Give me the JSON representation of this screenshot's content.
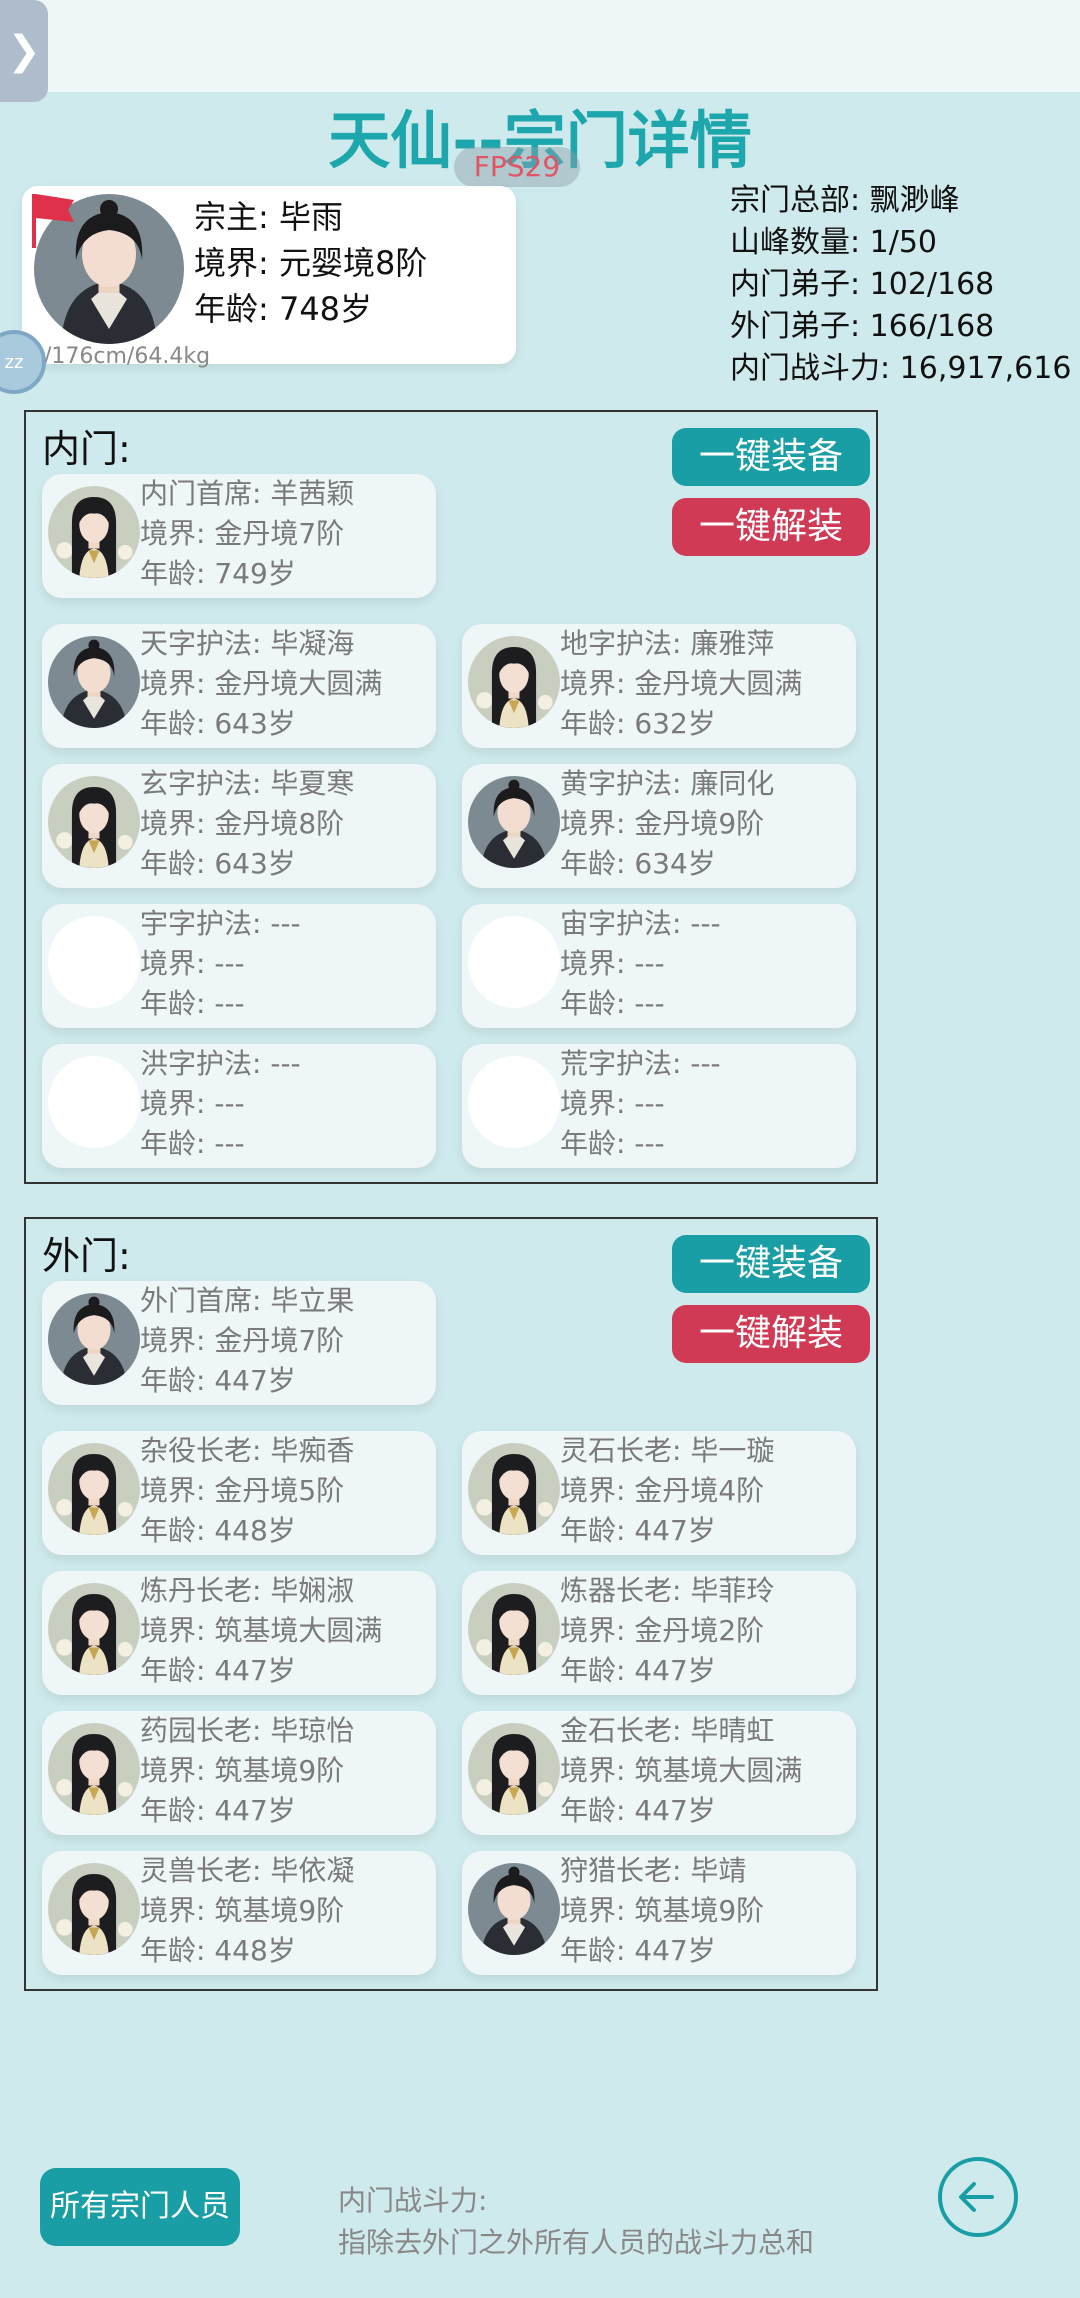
{
  "title": "天仙--宗门详情",
  "fps": "FPS29",
  "side_tab_glyph": "❯",
  "zz_badge": "zz",
  "leader": {
    "name_line": "宗主: 毕雨",
    "realm_line": "境界: 元婴境8阶",
    "age_line": "年龄: 748岁",
    "stats": "男/176cm/64.4kg",
    "avatar": "male"
  },
  "sect_info": {
    "hq": "宗门总部: 飘渺峰",
    "peaks": "山峰数量: 1/50",
    "inner_count": "内门弟子: 102/168",
    "outer_count": "外门弟子: 166/168",
    "power": "内门战斗力: 16,917,616"
  },
  "inner": {
    "label": "内门:",
    "equip_label": "一键装备",
    "unequip_label": "一键解装",
    "chief": {
      "title": "内门首席: 羊茜颖",
      "realm": "境界: 金丹境7阶",
      "age": "年龄: 749岁",
      "avatar": "female"
    },
    "members": [
      {
        "title": "天字护法: 毕凝海",
        "realm": "境界: 金丹境大圆满",
        "age": "年龄: 643岁",
        "avatar": "male"
      },
      {
        "title": "地字护法: 廉雅萍",
        "realm": "境界: 金丹境大圆满",
        "age": "年龄: 632岁",
        "avatar": "female"
      },
      {
        "title": "玄字护法: 毕夏寒",
        "realm": "境界: 金丹境8阶",
        "age": "年龄: 643岁",
        "avatar": "female"
      },
      {
        "title": "黄字护法: 廉同化",
        "realm": "境界: 金丹境9阶",
        "age": "年龄: 634岁",
        "avatar": "male"
      },
      {
        "title": "宇字护法: ---",
        "realm": "境界: ---",
        "age": "年龄: ---",
        "avatar": "empty"
      },
      {
        "title": "宙字护法: ---",
        "realm": "境界: ---",
        "age": "年龄: ---",
        "avatar": "empty"
      },
      {
        "title": "洪字护法: ---",
        "realm": "境界: ---",
        "age": "年龄: ---",
        "avatar": "empty"
      },
      {
        "title": "荒字护法: ---",
        "realm": "境界: ---",
        "age": "年龄: ---",
        "avatar": "empty"
      }
    ]
  },
  "outer": {
    "label": "外门:",
    "equip_label": "一键装备",
    "unequip_label": "一键解装",
    "chief": {
      "title": "外门首席: 毕立果",
      "realm": "境界: 金丹境7阶",
      "age": "年龄: 447岁",
      "avatar": "male"
    },
    "members": [
      {
        "title": "杂役长老: 毕痴香",
        "realm": "境界: 金丹境5阶",
        "age": "年龄: 448岁",
        "avatar": "female"
      },
      {
        "title": "灵石长老: 毕一璇",
        "realm": "境界: 金丹境4阶",
        "age": "年龄: 447岁",
        "avatar": "female"
      },
      {
        "title": "炼丹长老: 毕娴淑",
        "realm": "境界: 筑基境大圆满",
        "age": "年龄: 447岁",
        "avatar": "female"
      },
      {
        "title": "炼器长老: 毕菲玲",
        "realm": "境界: 金丹境2阶",
        "age": "年龄: 447岁",
        "avatar": "female"
      },
      {
        "title": "药园长老: 毕琼怡",
        "realm": "境界: 筑基境9阶",
        "age": "年龄: 447岁",
        "avatar": "female"
      },
      {
        "title": "金石长老: 毕晴虹",
        "realm": "境界: 筑基境大圆满",
        "age": "年龄: 447岁",
        "avatar": "female"
      },
      {
        "title": "灵兽长老: 毕依凝",
        "realm": "境界: 筑基境9阶",
        "age": "年龄: 448岁",
        "avatar": "female"
      },
      {
        "title": "狩猎长老: 毕靖",
        "realm": "境界: 筑基境9阶",
        "age": "年龄: 447岁",
        "avatar": "male"
      }
    ]
  },
  "bottom": {
    "all_members_label": "所有宗门人员",
    "note_title": "内门战斗力:",
    "note_text": "指除去外门之外所有人员的战斗力总和"
  },
  "colors": {
    "accent": "#1a9ea6",
    "danger": "#d03a55",
    "background": "#cfeaec"
  }
}
